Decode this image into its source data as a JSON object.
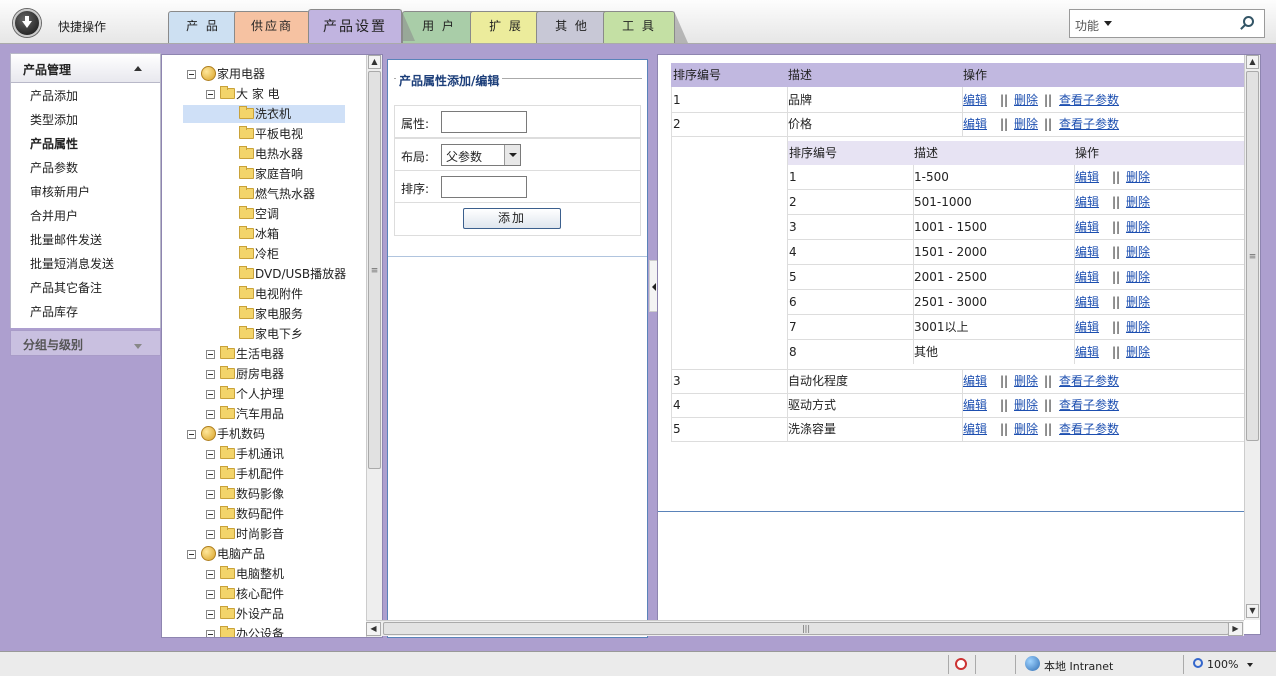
{
  "topbar": {
    "quick_label": "快捷操作",
    "tabs": [
      {
        "label": "产 品",
        "color": "#cde0f2"
      },
      {
        "label": "供应商",
        "color": "#f6c2a2"
      },
      {
        "label": "产品设置",
        "color": "#c1b4e0",
        "active": true
      },
      {
        "label": "用 户",
        "color": "#a9cda8"
      },
      {
        "label": "扩 展",
        "color": "#ecec9c"
      },
      {
        "label": "其 他",
        "color": "#c8c8d6"
      },
      {
        "label": "工 具",
        "color": "#c4e0a4"
      }
    ],
    "search_label": "功能"
  },
  "sidebar": {
    "section1": "产品管理",
    "items": [
      "产品添加",
      "类型添加",
      "产品属性",
      "产品参数",
      "审核新用户",
      "合并用户",
      "批量邮件发送",
      "批量短消息发送",
      "产品其它备注",
      "产品库存"
    ],
    "active_index": 2,
    "section2": "分组与级别"
  },
  "tree": {
    "n0": "家用电器",
    "n1": "大 家 电",
    "n2": "洗衣机",
    "n3": "平板电视",
    "n4": "电热水器",
    "n5": "家庭音响",
    "n6": "燃气热水器",
    "n7": "空调",
    "n8": "冰箱",
    "n9": "冷柜",
    "n10": "DVD/USB播放器",
    "n11": "电视附件",
    "n12": "家电服务",
    "n13": "家电下乡",
    "n14": "生活电器",
    "n15": "厨房电器",
    "n16": "个人护理",
    "n17": "汽车用品",
    "n18": "手机数码",
    "n19": "手机通讯",
    "n20": "手机配件",
    "n21": "数码影像",
    "n22": "数码配件",
    "n23": "时尚影音",
    "n24": "电脑产品",
    "n25": "电脑整机",
    "n26": "核心配件",
    "n27": "外设产品",
    "n28": "办公设备"
  },
  "form": {
    "legend": "产品属性添加/编辑",
    "attr_label": "属性:",
    "layout_label": "布局:",
    "layout_value": "父参数",
    "order_label": "排序:",
    "submit": "添加"
  },
  "table": {
    "headers": {
      "id": "排序编号",
      "desc": "描述",
      "ops": "操作"
    },
    "edit": "编辑",
    "sep": "||",
    "del": "删除",
    "view": "查看子参数",
    "rows": [
      {
        "id": "1",
        "desc": "品牌"
      },
      {
        "id": "2",
        "desc": "价格"
      },
      {
        "id": "3",
        "desc": "自动化程度"
      },
      {
        "id": "4",
        "desc": "驱动方式"
      },
      {
        "id": "5",
        "desc": "洗涤容量"
      }
    ],
    "sub_headers": {
      "id": "排序编号",
      "desc": "描述",
      "ops": "操作"
    },
    "sub_rows": [
      {
        "id": "1",
        "desc": "1-500"
      },
      {
        "id": "2",
        "desc": "501-1000"
      },
      {
        "id": "3",
        "desc": "1001 - 1500"
      },
      {
        "id": "4",
        "desc": "1501 - 2000"
      },
      {
        "id": "5",
        "desc": "2001 - 2500"
      },
      {
        "id": "6",
        "desc": "2501 - 3000"
      },
      {
        "id": "7",
        "desc": "3001以上"
      },
      {
        "id": "8",
        "desc": "其他"
      }
    ]
  },
  "scroll": {
    "grip": "≡",
    "hgrip": "|||"
  },
  "statusbar": {
    "zone": "本地 Intranet",
    "zoom": "100%"
  }
}
